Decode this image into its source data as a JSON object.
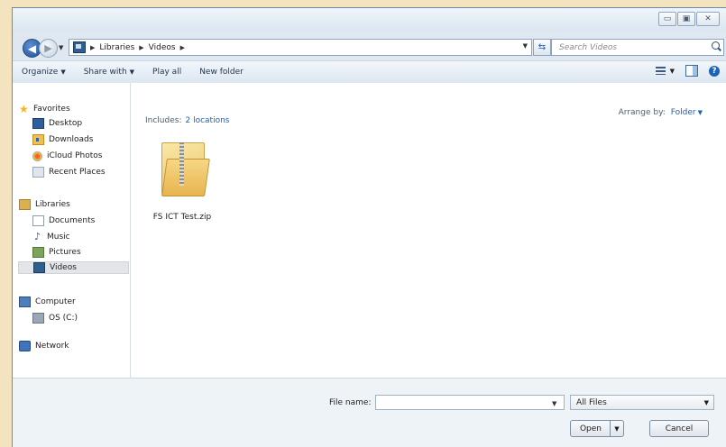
{
  "window": {
    "caption": {
      "minimize": "▭",
      "maximize": "▣",
      "close": "✕"
    }
  },
  "address": {
    "breadcrumbs": [
      "Libraries",
      "Videos"
    ],
    "search_placeholder": "Search Videos"
  },
  "toolbar": {
    "organize": "Organize",
    "share_with": "Share with",
    "play_all": "Play all",
    "new_folder": "New folder"
  },
  "nav": {
    "favorites": "Favorites",
    "desktop": "Desktop",
    "downloads": "Downloads",
    "icloud_photos": "iCloud Photos",
    "recent_places": "Recent Places",
    "libraries": "Libraries",
    "documents": "Documents",
    "music": "Music",
    "pictures": "Pictures",
    "videos": "Videos",
    "computer": "Computer",
    "os_drive": "OS (C:)",
    "network": "Network"
  },
  "content": {
    "includes_label": "Includes:",
    "includes_link": "2 locations",
    "arrange_label": "Arrange by:",
    "arrange_value": "Folder",
    "files": [
      {
        "name": "FS ICT Test.zip",
        "icon": "zip-folder-icon"
      }
    ]
  },
  "footer": {
    "file_name_label": "File name:",
    "file_name_value": "",
    "filter_value": "All Files",
    "open_label": "Open",
    "cancel_label": "Cancel"
  },
  "colors": {
    "accent": "#1f5fb5",
    "background": "#f3e3bf"
  }
}
